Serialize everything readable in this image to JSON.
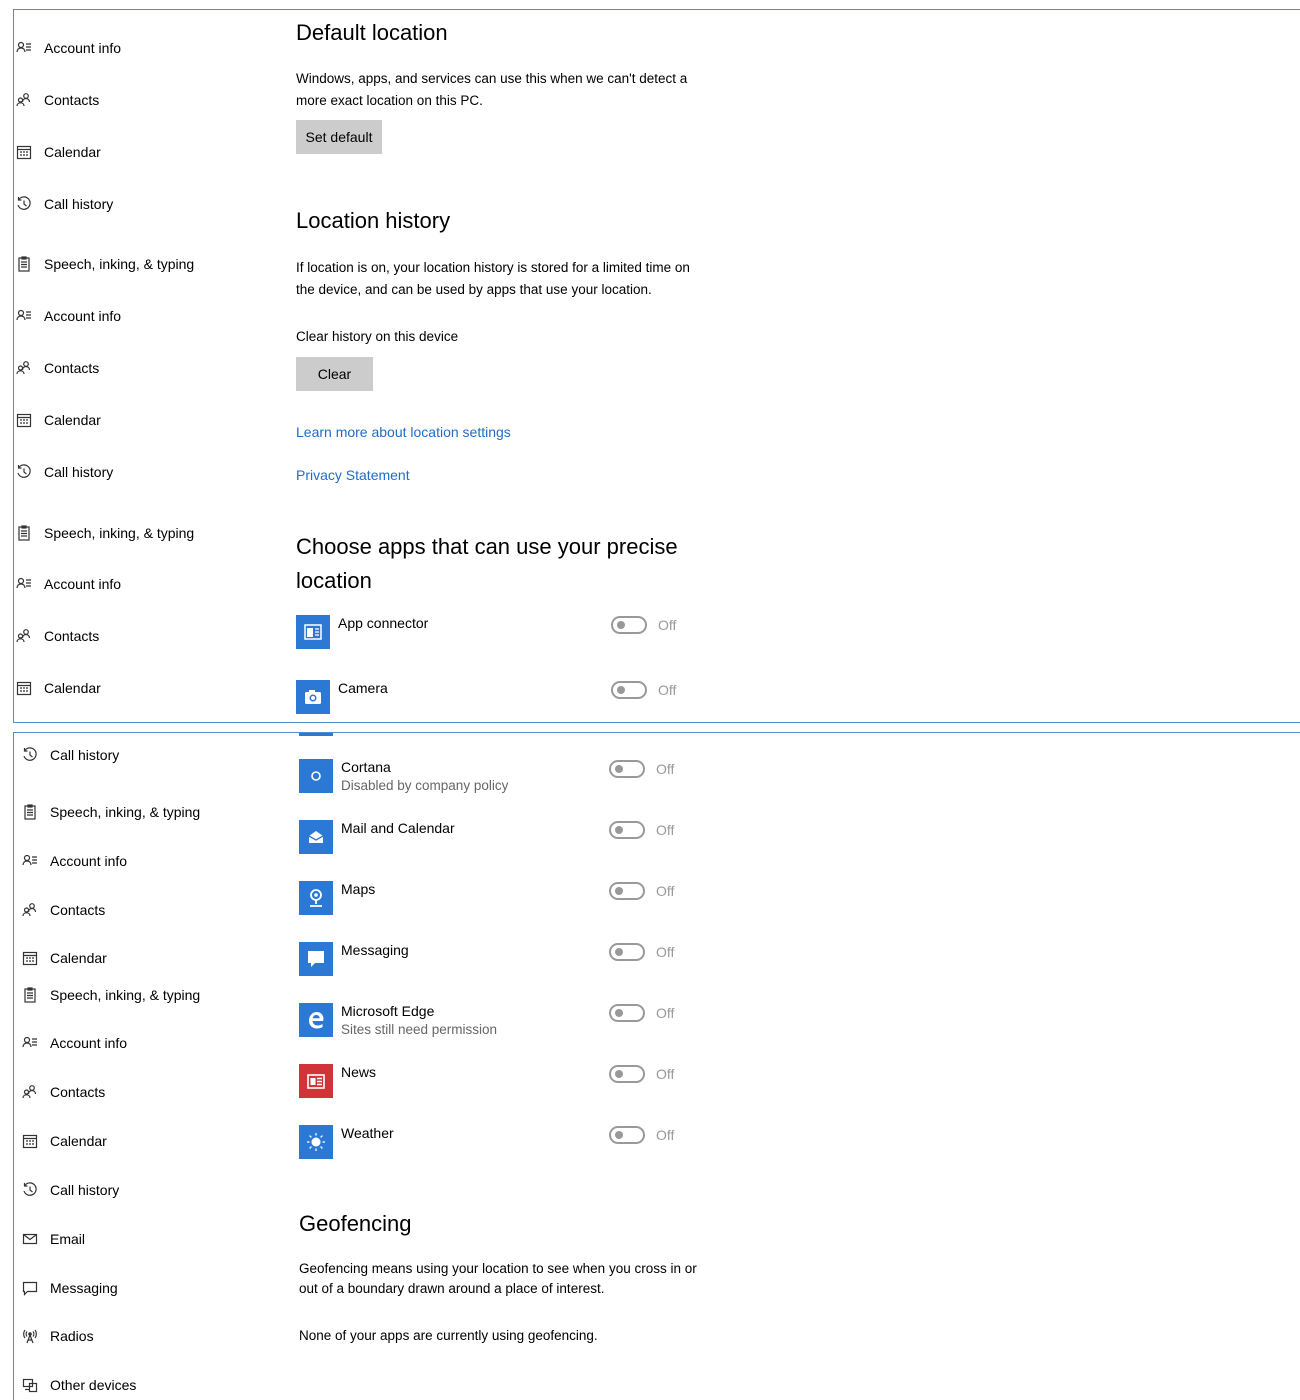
{
  "top_panel": {
    "sidebar": [
      {
        "label": "Account info",
        "icon": "account-info-icon"
      },
      {
        "label": "Contacts",
        "icon": "contacts-icon"
      },
      {
        "label": "Calendar",
        "icon": "calendar-icon"
      },
      {
        "label": "Call history",
        "icon": "call-history-icon"
      },
      {
        "label": "Speech, inking, & typing",
        "icon": "speech-icon"
      },
      {
        "label": "Account info",
        "icon": "account-info-icon"
      },
      {
        "label": "Contacts",
        "icon": "contacts-icon"
      },
      {
        "label": "Calendar",
        "icon": "calendar-icon"
      },
      {
        "label": "Call history",
        "icon": "call-history-icon"
      },
      {
        "label": "Speech, inking, & typing",
        "icon": "speech-icon"
      },
      {
        "label": "Account info",
        "icon": "account-info-icon"
      },
      {
        "label": "Contacts",
        "icon": "contacts-icon"
      },
      {
        "label": "Calendar",
        "icon": "calendar-icon"
      }
    ],
    "default_location": {
      "title": "Default location",
      "desc_line1": "Windows, apps, and services can use this when we can't detect a",
      "desc_line2": "more exact location on this PC.",
      "button": "Set default"
    },
    "location_history": {
      "title": "Location history",
      "desc_line1": "If location is on, your location history is stored for a limited time on",
      "desc_line2": "the device, and can be used by apps that use your location.",
      "clear_label": "Clear history on this device",
      "button": "Clear"
    },
    "links": {
      "learn_more": "Learn more about location settings",
      "privacy": "Privacy Statement"
    },
    "choose_apps": {
      "title_line1": "Choose apps that can use your precise",
      "title_line2": "location"
    },
    "apps": [
      {
        "name": "App connector",
        "state": "Off",
        "color": "#2b79d4",
        "icon": "app-connector-icon"
      },
      {
        "name": "Camera",
        "state": "Off",
        "color": "#2b79d4",
        "icon": "camera-icon"
      }
    ]
  },
  "bottom_panel": {
    "sidebar": [
      {
        "label": "Call history",
        "icon": "call-history-icon"
      },
      {
        "label": "Speech, inking, & typing",
        "icon": "speech-icon"
      },
      {
        "label": "Account info",
        "icon": "account-info-icon"
      },
      {
        "label": "Contacts",
        "icon": "contacts-icon"
      },
      {
        "label": "Calendar",
        "icon": "calendar-icon"
      },
      {
        "label": "Speech, inking, & typing",
        "icon": "speech-icon"
      },
      {
        "label": "Account info",
        "icon": "account-info-icon"
      },
      {
        "label": "Contacts",
        "icon": "contacts-icon"
      },
      {
        "label": "Calendar",
        "icon": "calendar-icon"
      },
      {
        "label": "Call history",
        "icon": "call-history-icon"
      },
      {
        "label": "Email",
        "icon": "email-icon"
      },
      {
        "label": "Messaging",
        "icon": "messaging-icon"
      },
      {
        "label": "Radios",
        "icon": "radios-icon"
      },
      {
        "label": "Other devices",
        "icon": "other-devices-icon"
      }
    ],
    "apps": [
      {
        "name": "Cortana",
        "sub": "Disabled by company policy",
        "state": "Off",
        "color": "#2b79d4",
        "icon": "cortana-icon"
      },
      {
        "name": "Mail and Calendar",
        "sub": "",
        "state": "Off",
        "color": "#2b79d4",
        "icon": "mail-icon"
      },
      {
        "name": "Maps",
        "sub": "",
        "state": "Off",
        "color": "#2b79d4",
        "icon": "maps-icon"
      },
      {
        "name": "Messaging",
        "sub": "",
        "state": "Off",
        "color": "#2b79d4",
        "icon": "messaging-app-icon"
      },
      {
        "name": "Microsoft Edge",
        "sub": "Sites still need permission",
        "state": "Off",
        "color": "#2b79d4",
        "icon": "edge-icon"
      },
      {
        "name": "News",
        "sub": "",
        "state": "Off",
        "color": "#d13438",
        "icon": "news-icon"
      },
      {
        "name": "Weather",
        "sub": "",
        "state": "Off",
        "color": "#2b79d4",
        "icon": "weather-icon"
      }
    ],
    "geofencing": {
      "title": "Geofencing",
      "desc_line1": "Geofencing means using your location to see when you cross in or",
      "desc_line2": "out of a boundary drawn around a place of interest.",
      "status": "None of your apps are currently using geofencing."
    }
  }
}
